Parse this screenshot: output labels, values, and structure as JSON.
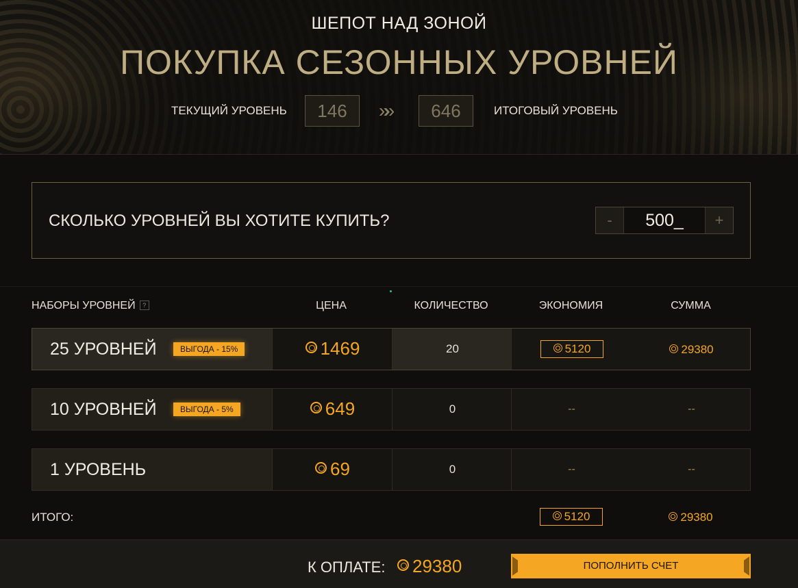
{
  "header": {
    "event_name": "ШЕПОТ НАД ЗОНОЙ",
    "title": "ПОКУПКА СЕЗОННЫХ УРОВНЕЙ",
    "current_level_label": "ТЕКУЩИЙ УРОВЕНЬ",
    "current_level": "146",
    "target_level_label": "ИТОГОВЫЙ УРОВЕНЬ",
    "target_level": "646",
    "arrow_glyph": "»»"
  },
  "quantity": {
    "question": "СКОЛЬКО УРОВНЕЙ ВЫ ХОТИТЕ КУПИТЬ?",
    "minus": "-",
    "plus": "+",
    "value": "500_"
  },
  "table": {
    "headers": {
      "bundles": "НАБОРЫ УРОВНЕЙ",
      "help": "?",
      "price": "ЦЕНА",
      "quantity": "КОЛИЧЕСТВО",
      "savings": "ЭКОНОМИЯ",
      "sum": "СУММА"
    },
    "rows": [
      {
        "name": "25 УРОВНЕЙ",
        "badge": "ВЫГОДА - 15%",
        "price": "1469",
        "quantity": "20",
        "savings": "5120",
        "sum": "29380"
      },
      {
        "name": "10 УРОВНЕЙ",
        "badge": "ВЫГОДА - 5%",
        "price": "649",
        "quantity": "0",
        "savings": "--",
        "sum": "--"
      },
      {
        "name": "1 УРОВЕНЬ",
        "badge": "",
        "price": "69",
        "quantity": "0",
        "savings": "--",
        "sum": "--"
      }
    ],
    "total_label": "ИТОГО:",
    "total_savings": "5120",
    "total_sum": "29380"
  },
  "footer": {
    "pay_label": "К ОПЛАТЕ:",
    "pay_amount": "29380",
    "topup_button": "ПОПОЛНИТЬ СЧЕТ"
  },
  "icons": {
    "currency": "sc-coin-icon"
  },
  "colors": {
    "accent": "#f5a623",
    "title_gold": "#bfad83",
    "background": "#0f0e0c"
  }
}
